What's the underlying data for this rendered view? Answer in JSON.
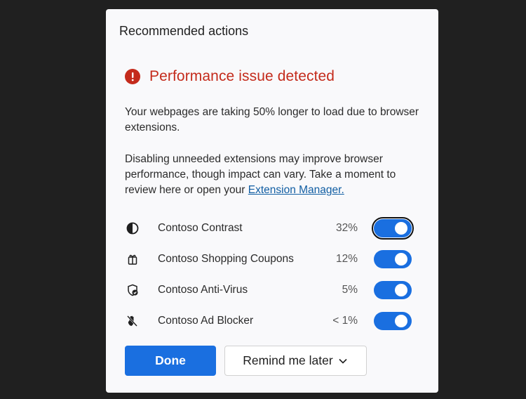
{
  "panel": {
    "title": "Recommended actions"
  },
  "alert": {
    "icon": "error-icon",
    "title": "Performance issue detected",
    "color": "#c42b1c"
  },
  "message": {
    "line1": "Your webpages are taking 50% longer to load due to browser extensions.",
    "line2_prefix": "Disabling unneeded extensions may improve browser performance, though impact can vary. Take a moment to review here or open your ",
    "link_text": "Extension Manager."
  },
  "extensions": [
    {
      "name": "Contoso Contrast",
      "impact": "32%",
      "icon": "contrast-icon",
      "enabled": true,
      "focused": true
    },
    {
      "name": "Contoso Shopping Coupons",
      "impact": "12%",
      "icon": "gift-icon",
      "enabled": true,
      "focused": false
    },
    {
      "name": "Contoso Anti-Virus",
      "impact": "5%",
      "icon": "shield-check-icon",
      "enabled": true,
      "focused": false
    },
    {
      "name": "Contoso Ad Blocker",
      "impact": "< 1%",
      "icon": "hand-block-icon",
      "enabled": true,
      "focused": false
    }
  ],
  "buttons": {
    "done": "Done",
    "remind": "Remind me later",
    "remind_icon": "chevron-down-icon"
  },
  "colors": {
    "accent": "#1a6fe0",
    "link": "#115ea3",
    "background": "#202020",
    "panel": "#f9f9fb"
  }
}
